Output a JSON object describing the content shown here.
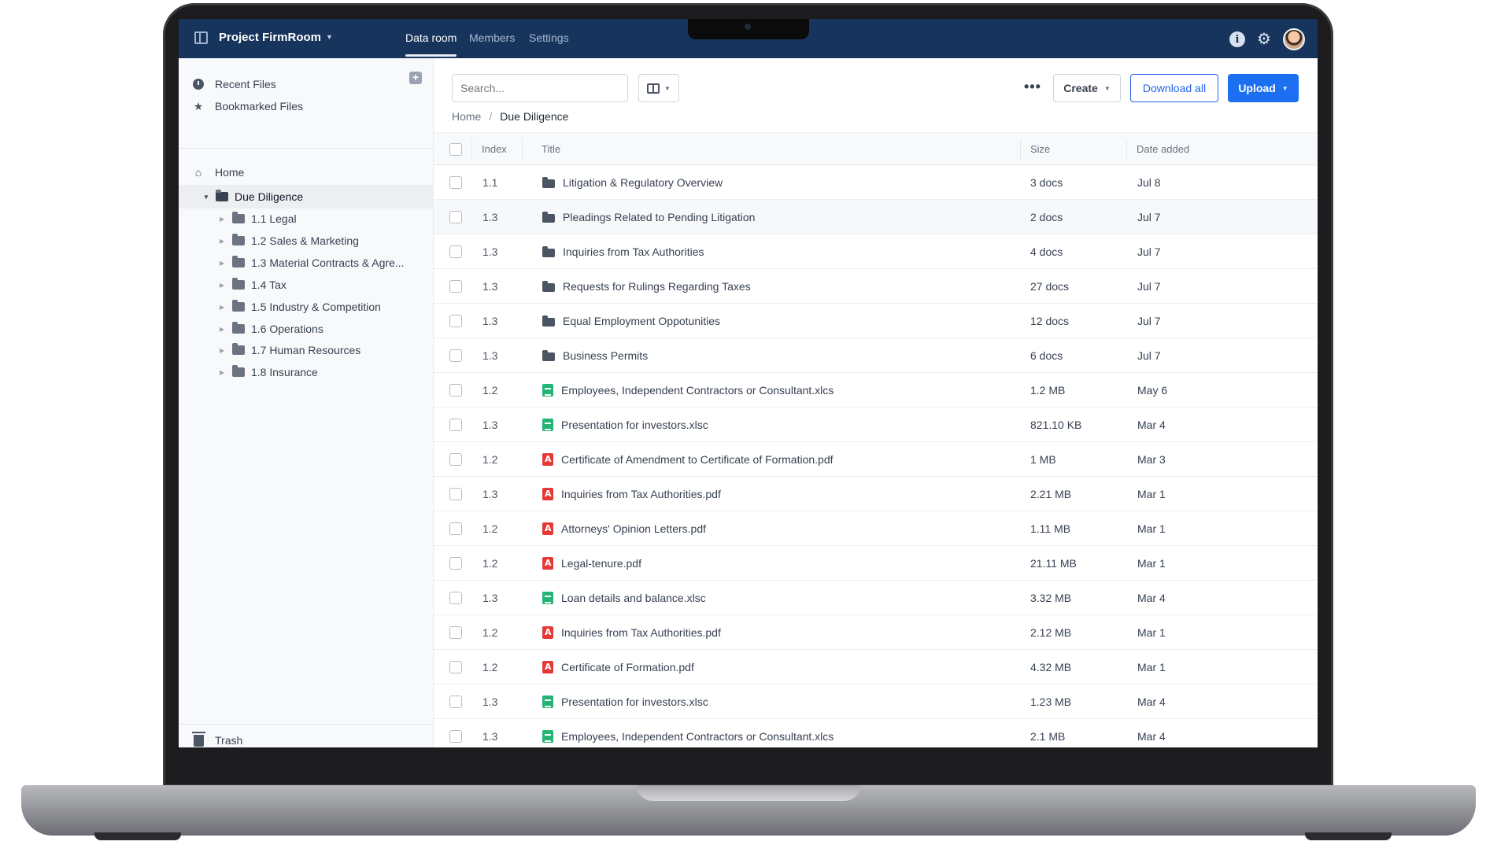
{
  "app": {
    "project_name": "Project FirmRoom",
    "tabs": [
      {
        "label": "Data room",
        "active": true
      },
      {
        "label": "Members",
        "active": false
      },
      {
        "label": "Settings",
        "active": false
      }
    ],
    "icons": [
      "panel-icon",
      "info-icon",
      "gear-icon",
      "avatar"
    ]
  },
  "sidebar": {
    "quick": [
      {
        "label": "Recent Files",
        "icon": "clock-icon"
      },
      {
        "label": "Bookmarked Files",
        "icon": "star-icon"
      }
    ],
    "home": "Home",
    "tree": {
      "root": "Due Diligence",
      "children": [
        "1.1 Legal",
        "1.2 Sales & Marketing",
        "1.3 Material Contracts & Agre...",
        "1.4 Tax",
        "1.5 Industry & Competition",
        "1.6 Operations",
        "1.7 Human Resources",
        "1.8 Insurance"
      ]
    },
    "trash": "Trash"
  },
  "toolbar": {
    "search_placeholder": "Search...",
    "create_label": "Create",
    "download_label": "Download all",
    "upload_label": "Upload"
  },
  "breadcrumb": {
    "home": "Home",
    "separator": "/",
    "current": "Due Diligence"
  },
  "table": {
    "headers": {
      "index": "Index",
      "title": "Title",
      "size": "Size",
      "date": "Date added"
    },
    "rows": [
      {
        "index": "1.1",
        "type": "folder",
        "title": "Litigation & Regulatory Overview",
        "size": "3 docs",
        "date": "Jul 8"
      },
      {
        "index": "1.3",
        "type": "folder",
        "title": "Pleadings Related to Pending Litigation",
        "size": "2 docs",
        "date": "Jul 7"
      },
      {
        "index": "1.3",
        "type": "folder",
        "title": "Inquiries from Tax Authorities",
        "size": "4 docs",
        "date": "Jul 7"
      },
      {
        "index": "1.3",
        "type": "folder",
        "title": "Requests for Rulings Regarding Taxes",
        "size": "27 docs",
        "date": "Jul 7"
      },
      {
        "index": "1.3",
        "type": "folder",
        "title": "Equal Employment Oppotunities",
        "size": "12 docs",
        "date": "Jul 7"
      },
      {
        "index": "1.3",
        "type": "folder",
        "title": "Business Permits",
        "size": "6 docs",
        "date": "Jul 7"
      },
      {
        "index": "1.2",
        "type": "sheet",
        "title": "Employees, Independent Contractors or Consultant.xlcs",
        "size": "1.2 MB",
        "date": "May 6"
      },
      {
        "index": "1.3",
        "type": "sheet",
        "title": "Presentation for investors.xlsc",
        "size": "821.10 KB",
        "date": "Mar 4"
      },
      {
        "index": "1.2",
        "type": "pdf",
        "title": "Certificate of Amendment to Certificate of Formation.pdf",
        "size": "1 MB",
        "date": "Mar 3"
      },
      {
        "index": "1.3",
        "type": "pdf",
        "title": "Inquiries from Tax Authorities.pdf",
        "size": "2.21 MB",
        "date": "Mar 1"
      },
      {
        "index": "1.2",
        "type": "pdf",
        "title": "Attorneys' Opinion Letters.pdf",
        "size": "1.11 MB",
        "date": "Mar 1"
      },
      {
        "index": "1.2",
        "type": "pdf",
        "title": "Legal-tenure.pdf",
        "size": "21.11 MB",
        "date": "Mar 1"
      },
      {
        "index": "1.3",
        "type": "sheet",
        "title": "Loan details and balance.xlsc",
        "size": "3.32 MB",
        "date": "Mar 4"
      },
      {
        "index": "1.2",
        "type": "pdf",
        "title": "Inquiries from Tax Authorities.pdf",
        "size": "2.12 MB",
        "date": "Mar 1"
      },
      {
        "index": "1.2",
        "type": "pdf",
        "title": "Certificate of Formation.pdf",
        "size": "4.32 MB",
        "date": "Mar 1"
      },
      {
        "index": "1.3",
        "type": "sheet",
        "title": "Presentation for investors.xlsc",
        "size": "1.23 MB",
        "date": "Mar 4"
      },
      {
        "index": "1.3",
        "type": "sheet",
        "title": "Employees, Independent Contractors or Consultant.xlcs",
        "size": "2.1 MB",
        "date": "Mar 4"
      }
    ]
  },
  "colors": {
    "topbar": "#17345c",
    "primary": "#1d6ff2",
    "folder": "#4b5563",
    "sheet": "#22b573",
    "pdf": "#e53935"
  }
}
